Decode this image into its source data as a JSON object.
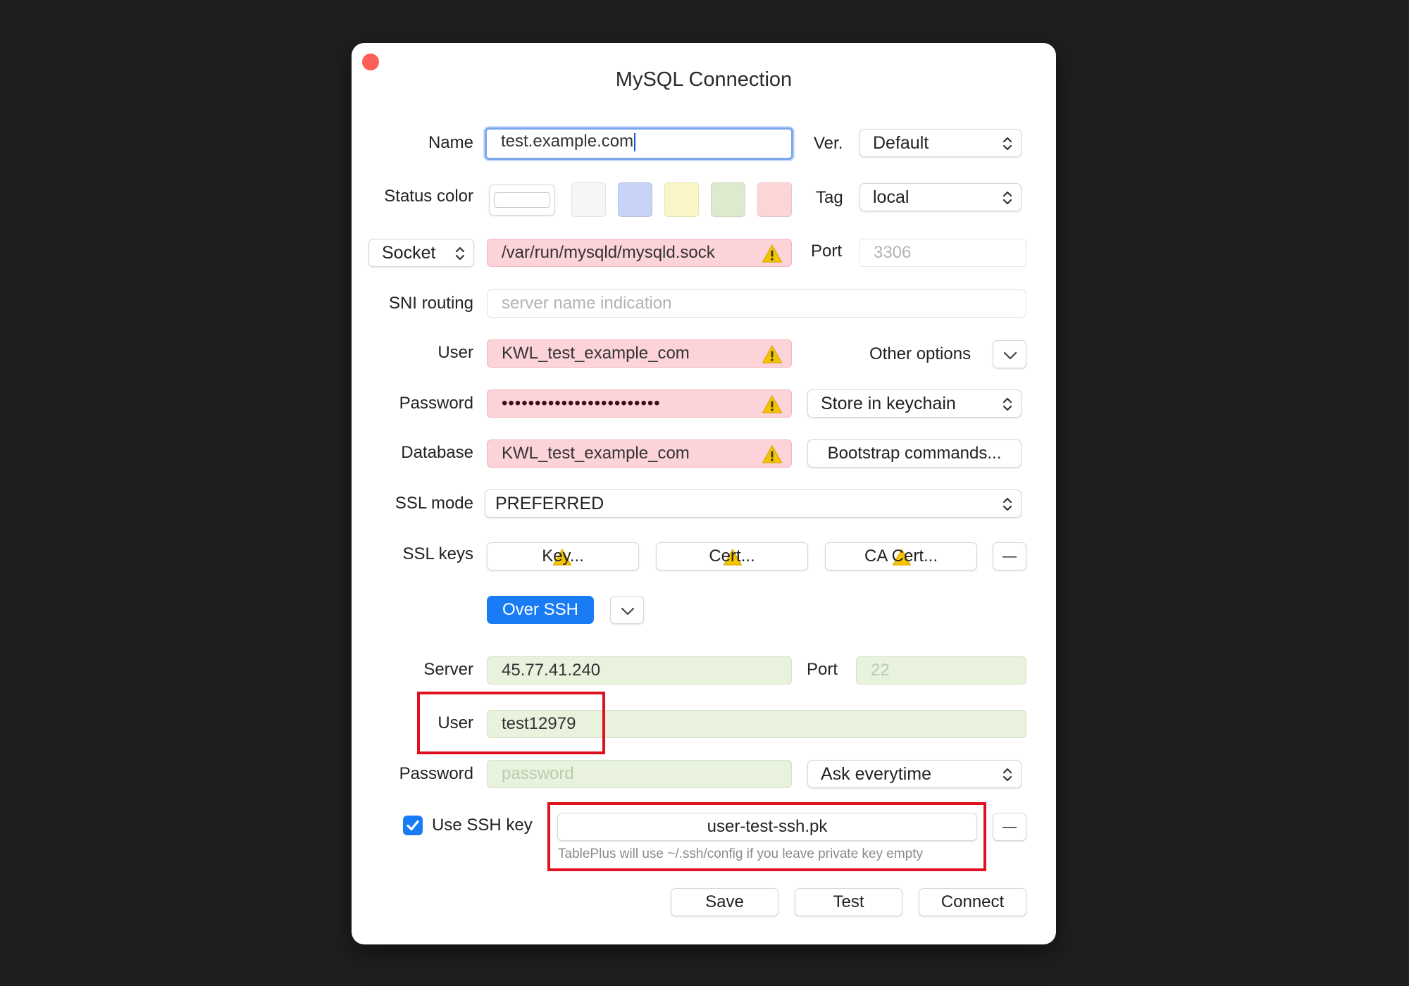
{
  "window": {
    "title": "MySQL Connection"
  },
  "name": {
    "label": "Name",
    "value": "test.example.com"
  },
  "version": {
    "label": "Ver.",
    "value": "Default"
  },
  "status_color": {
    "label": "Status color",
    "swatches": [
      "#f6f6f6",
      "#c7d3f7",
      "#faf6c8",
      "#dcebcd",
      "#fcd6d6"
    ]
  },
  "tag": {
    "label": "Tag",
    "value": "local"
  },
  "connection_type": {
    "value": "Socket"
  },
  "socket": {
    "value": "/var/run/mysqld/mysqld.sock"
  },
  "port": {
    "label": "Port",
    "placeholder": "3306"
  },
  "sni": {
    "label": "SNI routing",
    "placeholder": "server name indication"
  },
  "user": {
    "label": "User",
    "value": "KWL_test_example_com"
  },
  "other_options": {
    "label": "Other options"
  },
  "password": {
    "label": "Password",
    "value": "••••••••••••••••••••••••"
  },
  "password_store": {
    "value": "Store in keychain"
  },
  "database": {
    "label": "Database",
    "value": "KWL_test_example_com"
  },
  "bootstrap": {
    "label": "Bootstrap commands..."
  },
  "ssl_mode": {
    "label": "SSL mode",
    "value": "PREFERRED"
  },
  "ssl_keys": {
    "label": "SSL keys",
    "key": "Key...",
    "cert": "Cert...",
    "ca_cert": "CA Cert...",
    "remove": "—"
  },
  "over_ssh": {
    "label": "Over SSH"
  },
  "ssh": {
    "server_label": "Server",
    "server": "45.77.41.240",
    "port_label": "Port",
    "port_placeholder": "22",
    "user_label": "User",
    "user": "test12979",
    "password_label": "Password",
    "password_placeholder": "password",
    "password_mode": "Ask everytime",
    "use_key_label": "Use SSH key",
    "key_file": "user-test-ssh.pk",
    "key_hint": "TablePlus will use ~/.ssh/config if you leave private key empty",
    "remove": "—"
  },
  "actions": {
    "save": "Save",
    "test": "Test",
    "connect": "Connect"
  },
  "colors": {
    "warning": "#f5c400",
    "accent": "#1a7cf5",
    "annotation": "#e0101e",
    "close": "#fe5f57"
  }
}
